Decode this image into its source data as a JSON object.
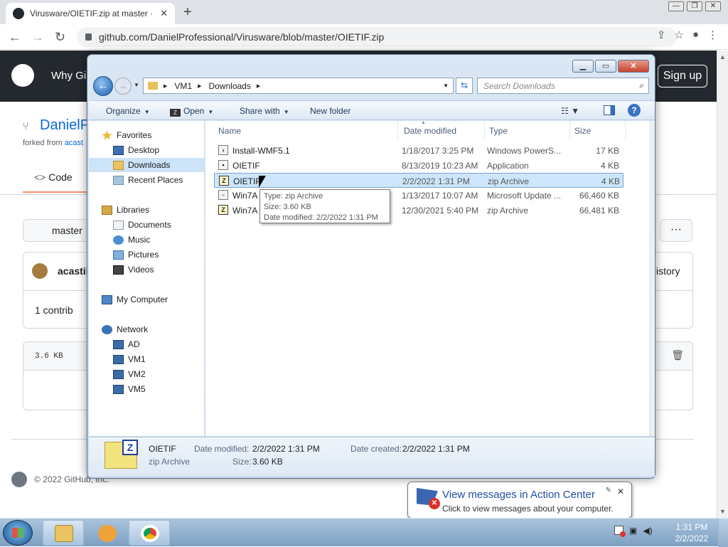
{
  "browser": {
    "tab_title": "Virusware/OIETIF.zip at master · D",
    "tab_close": "✕",
    "new_tab": "+",
    "url": "github.com/DanielProfessional/Virusware/blob/master/OIETIF.zip",
    "window_controls": [
      "—",
      "❐",
      "✕"
    ]
  },
  "github": {
    "why_github": "Why Gi",
    "sign_up": "Sign up",
    "repo_name": "DanielP",
    "forked_prefix": "forked from ",
    "forked_link": "acast",
    "code_tab": "Code",
    "branch": "master",
    "more": "···",
    "author": "acastil",
    "history": "istory",
    "contributors": "1 contrib",
    "file_size": "3.6 KB",
    "footer_copyright": "© 2022 GitHub, Inc."
  },
  "explorer": {
    "address_crumbs": [
      "VM1",
      "Downloads"
    ],
    "search_placeholder": "Search Downloads",
    "toolbar": {
      "organize": "Organize",
      "open": "Open",
      "share_with": "Share with",
      "new_folder": "New folder"
    },
    "nav": {
      "favorites": "Favorites",
      "desktop": "Desktop",
      "downloads": "Downloads",
      "recent_places": "Recent Places",
      "libraries": "Libraries",
      "documents": "Documents",
      "music": "Music",
      "pictures": "Pictures",
      "videos": "Videos",
      "my_computer": "My Computer",
      "network": "Network",
      "ad": "AD",
      "vm1": "VM1",
      "vm2": "VM2",
      "vm5": "VM5"
    },
    "columns": {
      "name": "Name",
      "date_modified": "Date modified",
      "type": "Type",
      "size": "Size"
    },
    "files": [
      {
        "name": "Install-WMF5.1",
        "date": "1/18/2017 3:25 PM",
        "type": "Windows PowerS...",
        "size": "17 KB",
        "icon": "script-file-icon"
      },
      {
        "name": "OIETIF",
        "date": "8/13/2019 10:23 AM",
        "type": "Application",
        "size": "4 KB",
        "icon": "application-icon"
      },
      {
        "name": "OIETIF",
        "date": "2/2/2022 1:31 PM",
        "type": "zip Archive",
        "size": "4 KB",
        "icon": "zip-icon"
      },
      {
        "name": "Win7A",
        "date": "1/13/2017 10:07 AM",
        "type": "Microsoft Update ...",
        "size": "66,460 KB",
        "icon": "update-package-icon"
      },
      {
        "name": "Win7A",
        "date": "12/30/2021 5:40 PM",
        "type": "zip Archive",
        "size": "66,481 KB",
        "icon": "zip-icon"
      }
    ],
    "tooltip": {
      "type": "Type: zip Archive",
      "size": "Size: 3.60 KB",
      "date": "Date modified: 2/2/2022 1:31 PM"
    },
    "details": {
      "name": "OIETIF",
      "type": "zip Archive",
      "date_modified_label": "Date modified:",
      "date_modified": "2/2/2022 1:31 PM",
      "size_label": "Size:",
      "size": "3.60 KB",
      "date_created_label": "Date created:",
      "date_created": "2/2/2022 1:31 PM"
    }
  },
  "balloon": {
    "title": "View messages in Action Center",
    "text": "Click to view messages about your computer."
  },
  "taskbar": {
    "time": "1:31 PM",
    "date": "2/2/2022"
  }
}
